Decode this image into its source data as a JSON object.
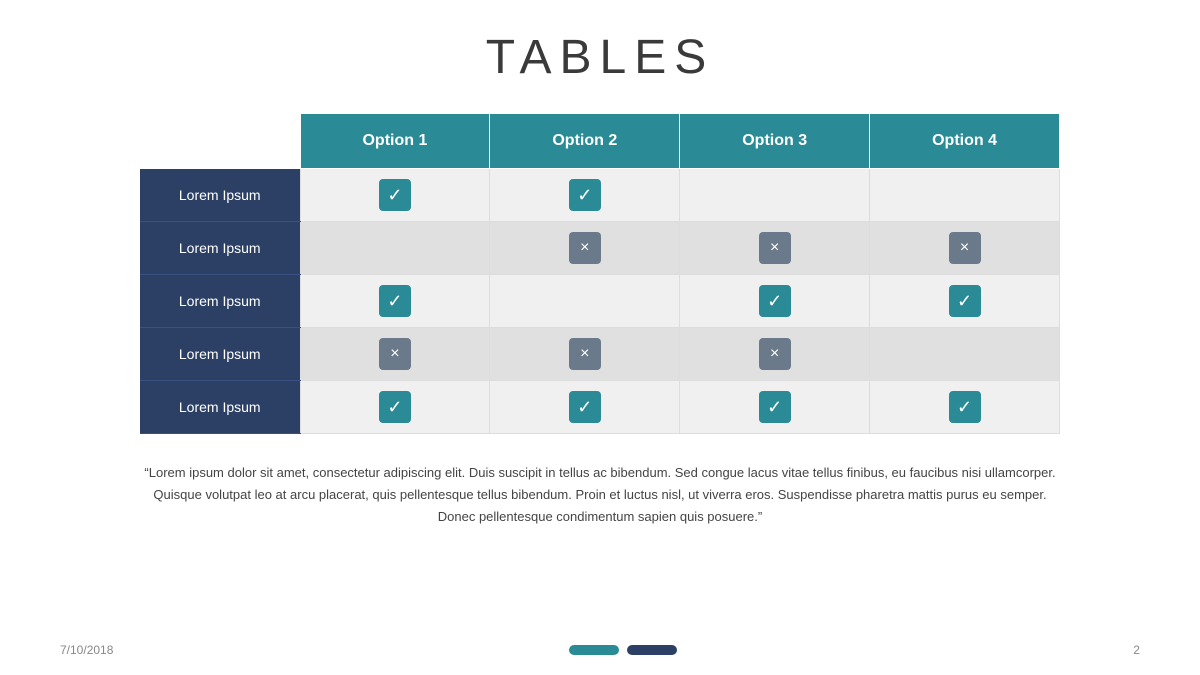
{
  "title": "TABLES",
  "table": {
    "headers": [
      "",
      "Option 1",
      "Option 2",
      "Option 3",
      "Option 4"
    ],
    "rows": [
      {
        "label": "Lorem Ipsum",
        "cells": [
          "check",
          "check",
          "",
          ""
        ]
      },
      {
        "label": "Lorem Ipsum",
        "cells": [
          "",
          "cross",
          "cross",
          "cross"
        ]
      },
      {
        "label": "Lorem Ipsum",
        "cells": [
          "check",
          "",
          "check",
          "check"
        ]
      },
      {
        "label": "Lorem Ipsum",
        "cells": [
          "cross",
          "cross",
          "cross",
          ""
        ]
      },
      {
        "label": "Lorem Ipsum",
        "cells": [
          "check",
          "check",
          "check",
          "check"
        ]
      }
    ]
  },
  "quote": "“Lorem ipsum dolor sit amet, consectetur adipiscing elit. Duis suscipit in tellus ac bibendum. Sed congue lacus vitae tellus finibus, eu faucibus nisi ullamcorper. Quisque volutpat leo at arcu placerat,  quis pellentesque tellus bibendum. Proin et luctus nisl, ut viverra eros. Suspendisse pharetra mattis purus eu semper. Donec pellentesque condimentum sapien quis posuere.”",
  "footer": {
    "date": "7/10/2018",
    "page": "2"
  },
  "icons": {
    "check": "✓",
    "cross": "×"
  }
}
